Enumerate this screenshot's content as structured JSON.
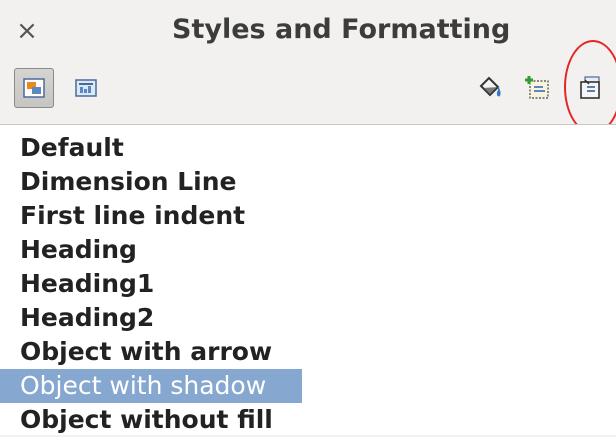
{
  "window": {
    "title": "Styles and Formatting",
    "close_glyph": "×"
  },
  "toolbar": {
    "buttons": [
      {
        "name": "graphics-styles-icon",
        "pressed": true
      },
      {
        "name": "presentation-styles-icon",
        "pressed": false
      },
      {
        "name": "fill-format-mode-icon",
        "pressed": false
      },
      {
        "name": "new-style-from-selection-icon",
        "pressed": false
      },
      {
        "name": "update-style-icon",
        "pressed": false,
        "annotated": true
      }
    ]
  },
  "annotation": {
    "color": "#e32727"
  },
  "styles_list": {
    "selected_color": "#86a8d0",
    "items": [
      "Default",
      "Dimension Line",
      "First line indent",
      "Heading",
      "Heading1",
      "Heading2",
      "Object with arrow",
      "Object with shadow",
      "Object without fill"
    ],
    "selected_index": 7
  }
}
